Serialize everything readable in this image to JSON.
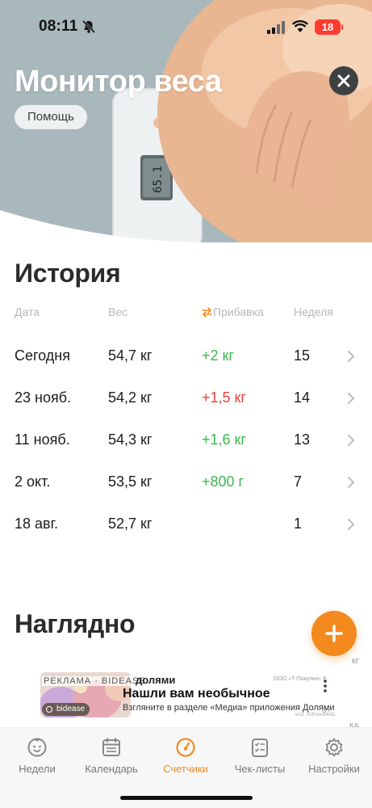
{
  "status": {
    "time": "08:11",
    "battery": "18"
  },
  "header": {
    "title": "Монитор веса",
    "help_label": "Помощь",
    "scale_display": "65.1"
  },
  "history": {
    "title": "История",
    "columns": {
      "date": "Дата",
      "weight": "Вес",
      "gain": "Прибавка",
      "week": "Неделя"
    },
    "rows": [
      {
        "date": "Сегодня",
        "weight": "54,7 кг",
        "gain": "+2 кг",
        "gain_color": "#3db84c",
        "week": "15"
      },
      {
        "date": "23 нояб.",
        "weight": "54,2 кг",
        "gain": "+1,5 кг",
        "gain_color": "#e8413d",
        "week": "14"
      },
      {
        "date": "11 нояб.",
        "weight": "54,3 кг",
        "gain": "+1,6 кг",
        "gain_color": "#3db84c",
        "week": "13"
      },
      {
        "date": "2 окт.",
        "weight": "53,5 кг",
        "gain": "+800 г",
        "gain_color": "#3db84c",
        "week": "7"
      },
      {
        "date": "18 авг.",
        "weight": "52,7 кг",
        "gain": "",
        "gain_color": "#3db84c",
        "week": "1"
      }
    ]
  },
  "visual": {
    "title": "Наглядно",
    "unit_label": "кг",
    "tick_label": "55"
  },
  "ad": {
    "tag": "РЕКЛАМА · BIDEASE",
    "top_word": "долями",
    "headline": "Нашли вам необычное",
    "subtext": "Взгляните в разделе «Медиа» приложения Долями",
    "legal": "ООО «Т-Покупки» Р...",
    "age": "0+",
    "erid": "erid: 2VfnxwvI4WL",
    "brand": "bidease"
  },
  "tabs": [
    {
      "label": "Недели",
      "icon": "baby-face-icon"
    },
    {
      "label": "Календарь",
      "icon": "calendar-icon"
    },
    {
      "label": "Счетчики",
      "icon": "gauge-icon",
      "active": true
    },
    {
      "label": "Чек-листы",
      "icon": "checklist-icon"
    },
    {
      "label": "Настройки",
      "icon": "gear-icon"
    }
  ],
  "colors": {
    "accent": "#f48a1e",
    "gain_positive": "#3db84c",
    "gain_negative": "#e8413d"
  }
}
